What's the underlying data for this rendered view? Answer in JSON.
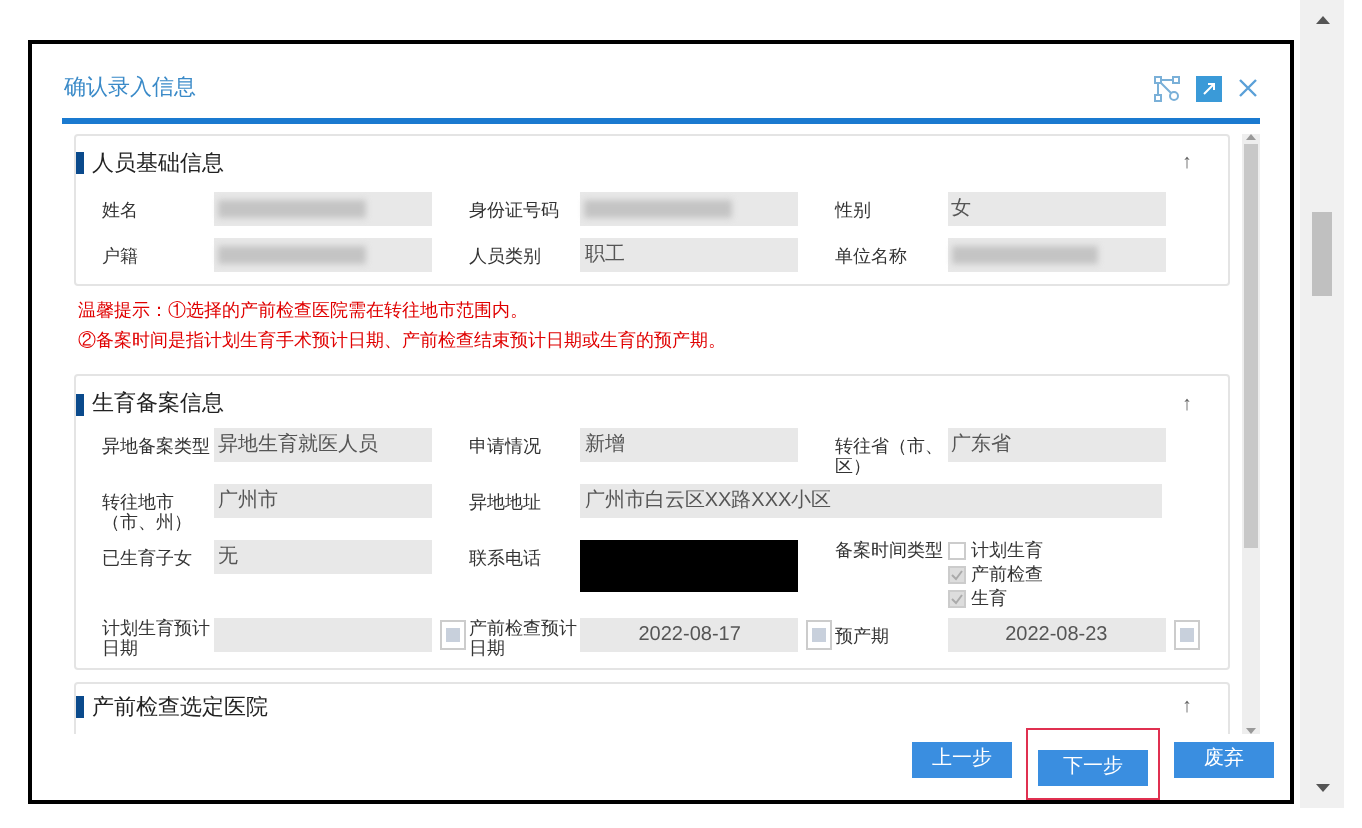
{
  "dialog": {
    "title": "确认录入信息"
  },
  "basic_section": {
    "title": "人员基础信息",
    "collapse_icon": "↑",
    "fields": [
      {
        "label": "姓名",
        "kind": "blurred"
      },
      {
        "label": "身份证号码",
        "kind": "blurred"
      },
      {
        "label": "性别",
        "kind": "text",
        "value": "女"
      },
      {
        "label": "户籍",
        "kind": "blurred"
      },
      {
        "label": "人员类别",
        "kind": "text",
        "value": "职工"
      },
      {
        "label": "单位名称",
        "kind": "blurred"
      }
    ]
  },
  "warnings": [
    "温馨提示：①选择的产前检查医院需在转往地市范围内。",
    "②备案时间是指计划生育手术预计日期、产前检查结束预计日期或生育的预产期。"
  ],
  "filing_section": {
    "title": "生育备案信息",
    "collapse_icon": "↑",
    "fields": [
      {
        "label": "异地备案类型",
        "kind": "text",
        "value": "异地生育就医人员"
      },
      {
        "label": "申请情况",
        "kind": "text",
        "value": "新增"
      },
      {
        "label": "转往省（市、区）",
        "kind": "text",
        "value": "广东省"
      },
      {
        "label": "转往地市（市、州）",
        "kind": "text",
        "value": "广州市"
      },
      {
        "label": "异地地址",
        "kind": "wide",
        "value": "广州市白云区XX路XXX小区"
      },
      {
        "label": "已生育子女",
        "kind": "text",
        "value": "无"
      },
      {
        "label": "联系电话",
        "kind": "redacted"
      },
      {
        "label": "备案时间类型",
        "kind": "checkboxes",
        "options": [
          {
            "label": "计划生育",
            "checked": false
          },
          {
            "label": "产前检查",
            "checked": true
          },
          {
            "label": "生育",
            "checked": true
          }
        ]
      },
      {
        "label": "计划生育预计日期",
        "kind": "date"
      },
      {
        "label": "产前检查预计日期",
        "kind": "date",
        "value": "2022-08-17"
      },
      {
        "label": "预产期",
        "kind": "date",
        "value": "2022-08-23"
      }
    ]
  },
  "hospital_section": {
    "title": "产前检查选定医院",
    "collapse_icon": "↑"
  },
  "buttons": [
    {
      "label": "上一步",
      "selected": false
    },
    {
      "label": "下一步",
      "selected": true
    },
    {
      "label": "废弃",
      "selected": false
    }
  ]
}
